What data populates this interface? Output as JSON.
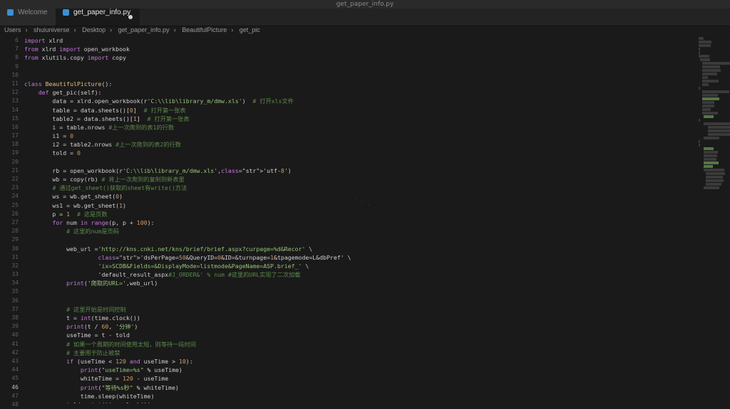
{
  "window": {
    "title": "get_paper_info.py"
  },
  "tabs": [
    {
      "label": "Welcome"
    },
    {
      "label": "get_paper_info.py"
    }
  ],
  "breadcrumbs": [
    "Users",
    "shuiuniverse",
    "Desktop",
    "get_paper_info.py",
    "BeautifulPicture",
    "get_pic"
  ],
  "editor": {
    "active_line": 46,
    "lines": [
      {
        "n": "6",
        "t": "import xlrd"
      },
      {
        "n": "7",
        "t": "from xlrd import open_workbook"
      },
      {
        "n": "8",
        "t": "from xlutils.copy import copy"
      },
      {
        "n": "9",
        "t": ""
      },
      {
        "n": "10",
        "t": ""
      },
      {
        "n": "11",
        "t": "class BeautifulPicture():"
      },
      {
        "n": "12",
        "t": "    def get_pic(self):"
      },
      {
        "n": "13",
        "t": "        data = xlrd.open_workbook(r'C:\\\\lib\\library_m/dmw.xls')  # 打开xls文件"
      },
      {
        "n": "14",
        "t": "        table = data.sheets()[0]  # 打开第一张表"
      },
      {
        "n": "15",
        "t": "        table2 = data.sheets()[1]  # 打开第一张表"
      },
      {
        "n": "16",
        "t": "        i = table.nrows #上一次爬到的表1的行数"
      },
      {
        "n": "17",
        "t": "        i1 = 0"
      },
      {
        "n": "18",
        "t": "        i2 = table2.nrows #上一次爬到的表2的行数"
      },
      {
        "n": "19",
        "t": "        told = 0"
      },
      {
        "n": "20",
        "t": ""
      },
      {
        "n": "21",
        "t": "        rb = open_workbook(r'C:\\\\lib\\library_m/dmw.xls','utf-8')"
      },
      {
        "n": "22",
        "t": "        wb = copy(rb) # 将上一次爬到的复制到新表里"
      },
      {
        "n": "23",
        "t": "        # 通过get_sheet()获取的sheet有write()方法"
      },
      {
        "n": "24",
        "t": "        ws = wb.get_sheet(0)"
      },
      {
        "n": "25",
        "t": "        ws1 = wb.get_sheet(1)"
      },
      {
        "n": "26",
        "t": "        p = 1  # 这是页数"
      },
      {
        "n": "27",
        "t": "        for num in range(p, p + 100):"
      },
      {
        "n": "28",
        "t": "            # 这里的num是页码"
      },
      {
        "n": "29",
        "t": ""
      },
      {
        "n": "30",
        "t": "            web_url ='http://kns.cnki.net/kns/brief/brief.aspx?curpage=%d&Recor' \\"
      },
      {
        "n": "31",
        "t": "                     'dsPerPage=50&QueryID=0&ID=&turnpage=1&tpagemode=L&dbPref' \\"
      },
      {
        "n": "32",
        "t": "                     'ix=SCDB&Fields=&DisplayMode=listmode&PageName=ASP.brief_' \\"
      },
      {
        "n": "33",
        "t": "                     'default_result_aspx#J_ORDER&' % num #这里的URL实现了二次加载"
      },
      {
        "n": "34",
        "t": "            print('爬取的URL=',web_url)"
      },
      {
        "n": "35",
        "t": ""
      },
      {
        "n": "36",
        "t": ""
      },
      {
        "n": "37",
        "t": "            # 这里开始是时间控制"
      },
      {
        "n": "38",
        "t": "            t = int(time.clock())"
      },
      {
        "n": "39",
        "t": "            print(t / 60, '分钟')"
      },
      {
        "n": "40",
        "t": "            useTime = t - told"
      },
      {
        "n": "41",
        "t": "            # 如果一个周期的时间使用太短，则等待一段时间"
      },
      {
        "n": "42",
        "t": "            # 主要用于防止被禁"
      },
      {
        "n": "43",
        "t": "            if (useTime < 120 and useTime > 10):"
      },
      {
        "n": "44",
        "t": "                print(\"useTime=%s\" % useTime)"
      },
      {
        "n": "45",
        "t": "                whiteTime = 120 - useTime"
      },
      {
        "n": "46",
        "t": "                print(\"等待%s秒\" % whiteTime)"
      },
      {
        "n": "47",
        "t": "                time.sleep(whiteTime)"
      },
      {
        "n": "48",
        "t": "            told = int(time.clock())"
      }
    ]
  },
  "colors": {
    "background": "#1a1a1a",
    "keyword": "#c678dd",
    "string": "#98c379",
    "comment": "#5c8a4a"
  }
}
